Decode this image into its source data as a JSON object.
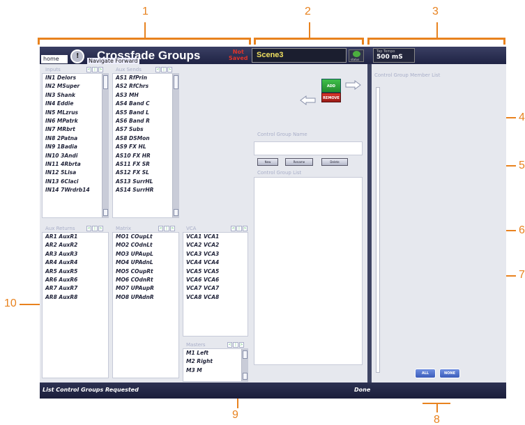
{
  "callouts": [
    "1",
    "2",
    "3",
    "4",
    "5",
    "6",
    "7",
    "8",
    "9",
    "10"
  ],
  "titlebar": {
    "home_label": "home",
    "title": "Crossfade Groups",
    "nav_tooltip": "Navigate Forward",
    "not_saved_1": "Not",
    "not_saved_2": "Saved",
    "scene": "Scene3",
    "status_label": "status",
    "tap_tempo_label": "Tap Tempo",
    "tap_tempo_value": "500 mS"
  },
  "inputs": {
    "header": "Inputs",
    "items": [
      "IN1 Delors",
      "IN2 MSuper",
      "IN3 Shank",
      "IN4 Eddie",
      "IN5 MLzrus",
      "IN6 MPatrk",
      "IN7 MRbrt",
      "IN8 2Patna",
      "IN9 1Badia",
      "IN10 3Andi",
      "IN11 4Rbrta",
      "IN12 5Lisa",
      "IN13 6Claci",
      "IN14 7Wrdrb14"
    ]
  },
  "aux_sends": {
    "header": "Aux Sends",
    "items": [
      "AS1 RfPrin",
      "AS2 RfChrs",
      "AS3 MH",
      "AS4 Band C",
      "AS5 Band L",
      "AS6 Band R",
      "AS7 Subs",
      "AS8 DSMon",
      "AS9 FX HL",
      "AS10 FX HR",
      "AS11 FX SR",
      "AS12 FX SL",
      "AS13 SurrHL",
      "AS14 SurrHR"
    ]
  },
  "aux_returns": {
    "header": "Aux Returns",
    "items": [
      "AR1 AuxR1",
      "AR2 AuxR2",
      "AR3 AuxR3",
      "AR4 AuxR4",
      "AR5 AuxR5",
      "AR6 AuxR6",
      "AR7 AuxR7",
      "AR8 AuxR8"
    ]
  },
  "matrix": {
    "header": "Matrix",
    "items": [
      "MO1 COupLt",
      "MO2 COdnLt",
      "MO3 UPAupL",
      "MO4 UPAdnL",
      "MO5 COupRt",
      "MO6 COdnRt",
      "MO7 UPAupR",
      "MO8 UPAdnR"
    ]
  },
  "vca": {
    "header": "VCA",
    "items": [
      "VCA1 VCA1",
      "VCA2 VCA2",
      "VCA3 VCA3",
      "VCA4 VCA4",
      "VCA5 VCA5",
      "VCA6 VCA6",
      "VCA7 VCA7",
      "VCA8 VCA8"
    ]
  },
  "masters": {
    "header": "Masters",
    "items": [
      "M1 Left",
      "M2 Right",
      "M3 M"
    ]
  },
  "scroll_mini": [
    "<",
    "|",
    ">"
  ],
  "middle": {
    "add_label": "ADD",
    "remove_label": "REMOVE",
    "cg_name_label": "Control Group Name",
    "btn_new": "New",
    "btn_rename": "Rename",
    "btn_delete": "Delete",
    "cg_list_label": "Control Group List"
  },
  "right": {
    "member_list_label": "Control Group Member List",
    "all_label": "ALL",
    "none_label": "NONE"
  },
  "statusbar": {
    "left": "List Control Groups Requested",
    "right": "Done"
  },
  "colors": {
    "accent": "#e8821e",
    "title_bg": "#1f2344",
    "scene_text": "#f0e060"
  }
}
